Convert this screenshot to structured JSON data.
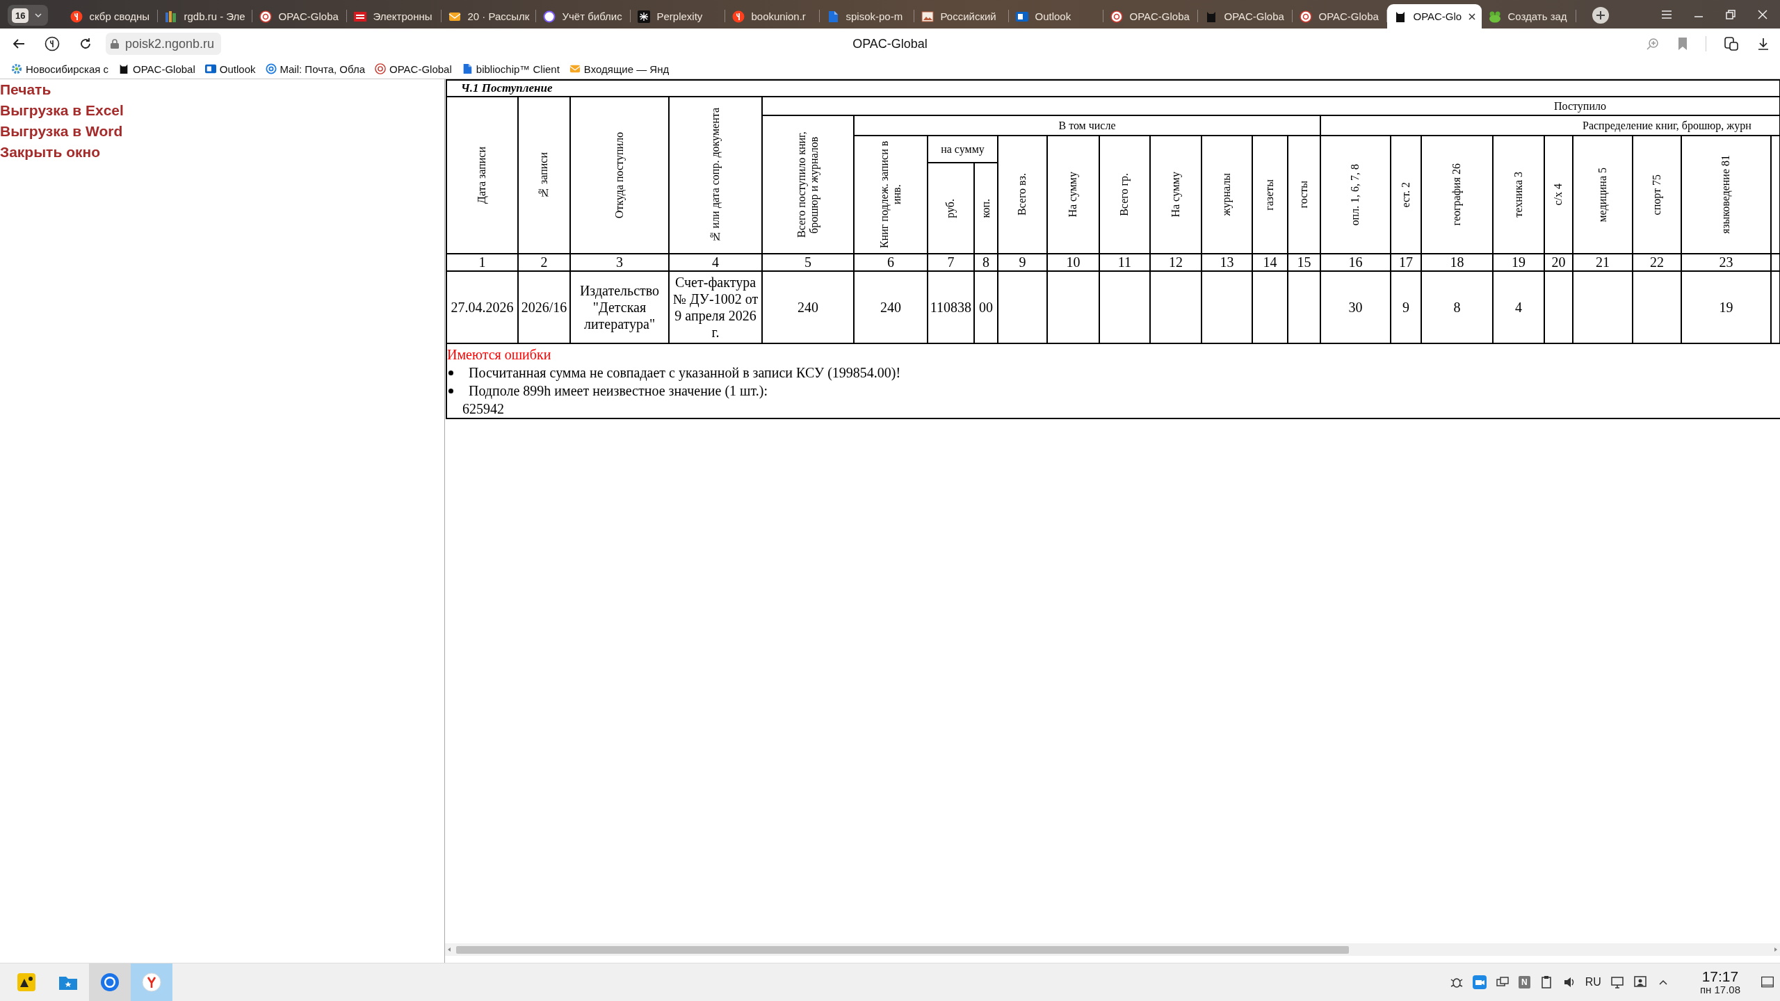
{
  "browser": {
    "tab_counter": "16",
    "tabs": [
      {
        "title": "скбр сводны",
        "selected": false
      },
      {
        "title": "rgdb.ru - Эле",
        "selected": false
      },
      {
        "title": "OPAC-Globa",
        "selected": false
      },
      {
        "title": "Электронны",
        "selected": false
      },
      {
        "title": "20 · Рассылк",
        "selected": false
      },
      {
        "title": "Учёт библис",
        "selected": false
      },
      {
        "title": "Perplexity",
        "selected": false
      },
      {
        "title": "bookunion.r",
        "selected": false
      },
      {
        "title": "spisok-po-m",
        "selected": false
      },
      {
        "title": "Российский",
        "selected": false
      },
      {
        "title": "Outlook",
        "selected": false
      },
      {
        "title": "OPAC-Globa",
        "selected": false
      },
      {
        "title": "OPAC-Globa",
        "selected": false
      },
      {
        "title": "OPAC-Globa",
        "selected": false
      },
      {
        "title": "OPAC-Glo",
        "selected": true
      },
      {
        "title": "Создать зад",
        "selected": false
      }
    ],
    "address": "poisk2.ngonb.ru",
    "page_title": "OPAC-Global",
    "bookmarks": [
      "Новосибирская с",
      "OPAC-Global",
      "Outlook",
      "Mail: Почта, Обла",
      "OPAC-Global",
      "bibliochip™ Client",
      "Входящие — Янд"
    ]
  },
  "sidebar": {
    "links": [
      "Печать",
      "Выгрузка в Excel",
      "Выгрузка в Word",
      "Закрыть окно"
    ]
  },
  "report": {
    "title": "Ч.1 Поступление",
    "group_header": "Поступило",
    "subgroup_headers": [
      "В том числе",
      "Распределение книг, брошюр, журн"
    ],
    "sum_header": "на сумму",
    "columns": [
      {
        "number": "1",
        "heading": "Дата записи"
      },
      {
        "number": "2",
        "heading": "№ записи"
      },
      {
        "number": "3",
        "heading": "Откуда поступило"
      },
      {
        "number": "4",
        "heading": "№ или дата сопр. документа"
      },
      {
        "number": "5",
        "heading": "Всего поступило книг, брошюр и журналов"
      },
      {
        "number": "6",
        "heading": "Книг подлеж. записи в инв."
      },
      {
        "number": "7",
        "heading": "руб."
      },
      {
        "number": "8",
        "heading": "коп."
      },
      {
        "number": "9",
        "heading": "Всего вз."
      },
      {
        "number": "10",
        "heading": "На сумму"
      },
      {
        "number": "11",
        "heading": "Всего гр."
      },
      {
        "number": "12",
        "heading": "На сумму"
      },
      {
        "number": "13",
        "heading": "журналы"
      },
      {
        "number": "14",
        "heading": "газеты"
      },
      {
        "number": "15",
        "heading": "госты"
      },
      {
        "number": "16",
        "heading": "опл. 1, 6, 7, 8"
      },
      {
        "number": "17",
        "heading": "ест. 2"
      },
      {
        "number": "18",
        "heading": "география 26"
      },
      {
        "number": "19",
        "heading": "техника 3"
      },
      {
        "number": "20",
        "heading": "с/х 4"
      },
      {
        "number": "21",
        "heading": "медицина 5"
      },
      {
        "number": "22",
        "heading": "спорт 75"
      },
      {
        "number": "23",
        "heading": "языковедение 81"
      }
    ],
    "rows": [
      {
        "cells": [
          "27.04.2026",
          "2026/16",
          "Издательство \"Детская литература\"",
          "Счет-фактура № ДУ-1002 от 9 апреля 2026 г.",
          "240",
          "240",
          "110838",
          "00",
          null,
          null,
          null,
          null,
          null,
          null,
          null,
          "30",
          "9",
          "8",
          "4",
          null,
          null,
          null,
          "19"
        ]
      }
    ],
    "errors": {
      "title": "Имеются ошибки",
      "items": [
        "Посчитанная сумма не совпадает с указанной в записи КСУ (199854.00)!",
        "Подполе 899h имеет неизвестное значение (1 шт.):"
      ],
      "note": "625942"
    }
  },
  "taskbar": {
    "tray_badge": "N",
    "language": "RU",
    "time": "17:17",
    "date": "пн 17.08"
  }
}
